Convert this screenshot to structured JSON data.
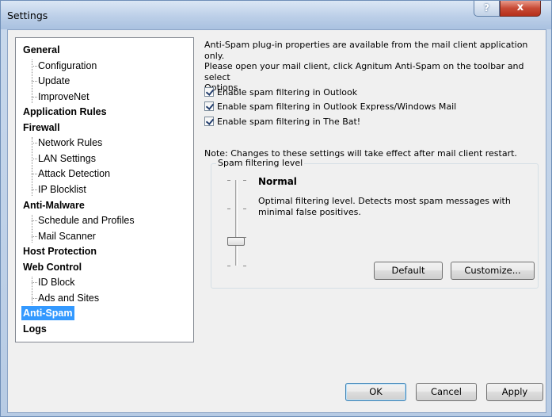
{
  "window": {
    "title": "Settings",
    "help_label": "?",
    "close_label": "x"
  },
  "tree": [
    {
      "label": "General",
      "level": 0
    },
    {
      "label": "Configuration",
      "level": 1
    },
    {
      "label": "Update",
      "level": 1
    },
    {
      "label": "ImproveNet",
      "level": 1
    },
    {
      "label": "Application Rules",
      "level": 0
    },
    {
      "label": "Firewall",
      "level": 0
    },
    {
      "label": "Network Rules",
      "level": 1
    },
    {
      "label": "LAN Settings",
      "level": 1
    },
    {
      "label": "Attack Detection",
      "level": 1
    },
    {
      "label": "IP Blocklist",
      "level": 1
    },
    {
      "label": "Anti-Malware",
      "level": 0
    },
    {
      "label": "Schedule and Profiles",
      "level": 1
    },
    {
      "label": "Mail Scanner",
      "level": 1
    },
    {
      "label": "Host Protection",
      "level": 0
    },
    {
      "label": "Web Control",
      "level": 0
    },
    {
      "label": "ID Block",
      "level": 1
    },
    {
      "label": "Ads and Sites",
      "level": 1
    },
    {
      "label": "Anti-Spam",
      "level": 0,
      "selected": true
    },
    {
      "label": "Logs",
      "level": 0
    }
  ],
  "panel": {
    "intro_line1": "Anti-Spam plug-in properties are available from the mail client application only.",
    "intro_line2": "Please open your mail client, click Agnitum Anti-Spam on the toolbar and select",
    "intro_line3": "Options.",
    "checkboxes": [
      {
        "label": "Enable spam filtering in Outlook",
        "checked": true
      },
      {
        "label": "Enable spam filtering in Outlook Express/Windows Mail",
        "checked": true
      },
      {
        "label": "Enable spam filtering in The Bat!",
        "checked": true
      }
    ],
    "note": "Note: Changes to these settings will take effect after mail client restart.",
    "group_title": "Spam filtering level",
    "level_name": "Normal",
    "level_desc": "Optimal filtering level. Detects most spam messages with minimal false positives.",
    "slider_position": 0.667,
    "default_label": "Default",
    "customize_label": "Customize..."
  },
  "footer": {
    "ok_label": "OK",
    "cancel_label": "Cancel",
    "apply_label": "Apply"
  },
  "colors": {
    "selection": "#3399ff",
    "face": "#f0f0f0",
    "title_gradient_top": "#dbe7f5"
  }
}
